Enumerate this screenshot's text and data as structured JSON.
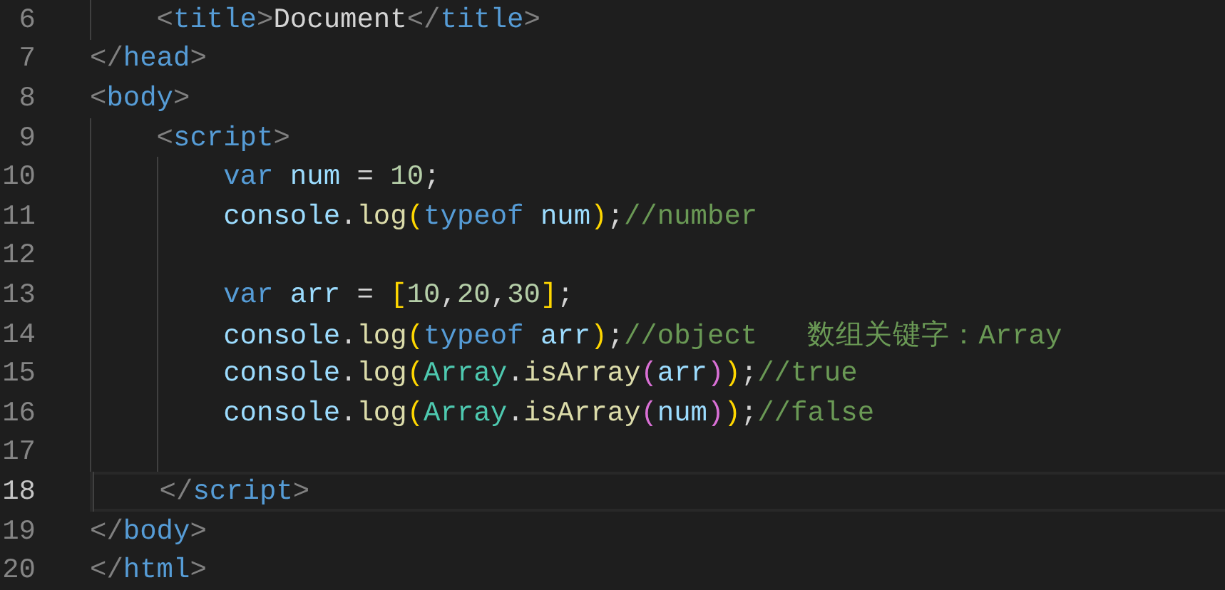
{
  "editor": {
    "lines": [
      {
        "children": [
          {
            "number": "6",
            "current": false,
            "tokens": [
              {
                "kind": "tagbracket",
                "text": "<"
              },
              {
                "kind": "tag",
                "text": "title"
              },
              {
                "kind": "tagbracket",
                "text": ">"
              },
              {
                "kind": "text",
                "text": "Document"
              },
              {
                "kind": "tagbracket",
                "text": "</"
              },
              {
                "kind": "tag",
                "text": "title"
              },
              {
                "kind": "tagbracket",
                "text": ">"
              }
            ]
          }
        ]
      },
      {
        "number": "7",
        "current": false,
        "tokens": [
          {
            "kind": "tagbracket",
            "text": "</"
          },
          {
            "kind": "tag",
            "text": "head"
          },
          {
            "kind": "tagbracket",
            "text": ">"
          }
        ]
      },
      {
        "number": "8",
        "current": false,
        "tokens": [
          {
            "kind": "tagbracket",
            "text": "<"
          },
          {
            "kind": "tag",
            "text": "body"
          },
          {
            "kind": "tagbracket",
            "text": ">"
          }
        ],
        "children": [
          {
            "number": "9",
            "current": false,
            "tokens": [
              {
                "kind": "tagbracket",
                "text": "<"
              },
              {
                "kind": "tag",
                "text": "script"
              },
              {
                "kind": "tagbracket",
                "text": ">"
              }
            ],
            "children": [
              {
                "number": "10",
                "current": false,
                "tokens": [
                  {
                    "kind": "keyword",
                    "text": "var "
                  },
                  {
                    "kind": "variable",
                    "text": "num"
                  },
                  {
                    "kind": "punct",
                    "text": " = "
                  },
                  {
                    "kind": "number",
                    "text": "10"
                  },
                  {
                    "kind": "punct",
                    "text": ";"
                  }
                ]
              },
              {
                "number": "11",
                "current": false,
                "tokens": [
                  {
                    "kind": "variable",
                    "text": "console"
                  },
                  {
                    "kind": "punct",
                    "text": "."
                  },
                  {
                    "kind": "function",
                    "text": "log"
                  },
                  {
                    "kind": "bracket1",
                    "text": "("
                  },
                  {
                    "kind": "keyword",
                    "text": "typeof "
                  },
                  {
                    "kind": "variable",
                    "text": "num"
                  },
                  {
                    "kind": "bracket1",
                    "text": ")"
                  },
                  {
                    "kind": "punct",
                    "text": ";"
                  },
                  {
                    "kind": "comment",
                    "text": "//number"
                  }
                ]
              },
              {
                "number": "12",
                "current": false
              },
              {
                "number": "13",
                "current": false,
                "tokens": [
                  {
                    "kind": "keyword",
                    "text": "var "
                  },
                  {
                    "kind": "variable",
                    "text": "arr"
                  },
                  {
                    "kind": "punct",
                    "text": " = "
                  },
                  {
                    "kind": "bracket1",
                    "text": "["
                  },
                  {
                    "kind": "number",
                    "text": "10"
                  },
                  {
                    "kind": "punct",
                    "text": ","
                  },
                  {
                    "kind": "number",
                    "text": "20"
                  },
                  {
                    "kind": "punct",
                    "text": ","
                  },
                  {
                    "kind": "number",
                    "text": "30"
                  },
                  {
                    "kind": "bracket1",
                    "text": "]"
                  },
                  {
                    "kind": "punct",
                    "text": ";"
                  }
                ]
              },
              {
                "number": "14",
                "current": false,
                "tokens": [
                  {
                    "kind": "variable",
                    "text": "console"
                  },
                  {
                    "kind": "punct",
                    "text": "."
                  },
                  {
                    "kind": "function",
                    "text": "log"
                  },
                  {
                    "kind": "bracket1",
                    "text": "("
                  },
                  {
                    "kind": "keyword",
                    "text": "typeof "
                  },
                  {
                    "kind": "variable",
                    "text": "arr"
                  },
                  {
                    "kind": "bracket1",
                    "text": ")"
                  },
                  {
                    "kind": "punct",
                    "text": ";"
                  },
                  {
                    "kind": "comment",
                    "text": "//object   数组关键字：Array"
                  }
                ]
              },
              {
                "number": "15",
                "current": false,
                "tokens": [
                  {
                    "kind": "variable",
                    "text": "console"
                  },
                  {
                    "kind": "punct",
                    "text": "."
                  },
                  {
                    "kind": "function",
                    "text": "log"
                  },
                  {
                    "kind": "bracket1",
                    "text": "("
                  },
                  {
                    "kind": "class",
                    "text": "Array"
                  },
                  {
                    "kind": "punct",
                    "text": "."
                  },
                  {
                    "kind": "function",
                    "text": "isArray"
                  },
                  {
                    "kind": "bracket2",
                    "text": "("
                  },
                  {
                    "kind": "variable",
                    "text": "arr"
                  },
                  {
                    "kind": "bracket2",
                    "text": ")"
                  },
                  {
                    "kind": "bracket1",
                    "text": ")"
                  },
                  {
                    "kind": "punct",
                    "text": ";"
                  },
                  {
                    "kind": "comment",
                    "text": "//true"
                  }
                ]
              },
              {
                "number": "16",
                "current": false,
                "tokens": [
                  {
                    "kind": "variable",
                    "text": "console"
                  },
                  {
                    "kind": "punct",
                    "text": "."
                  },
                  {
                    "kind": "function",
                    "text": "log"
                  },
                  {
                    "kind": "bracket1",
                    "text": "("
                  },
                  {
                    "kind": "class",
                    "text": "Array"
                  },
                  {
                    "kind": "punct",
                    "text": "."
                  },
                  {
                    "kind": "function",
                    "text": "isArray"
                  },
                  {
                    "kind": "bracket2",
                    "text": "("
                  },
                  {
                    "kind": "variable",
                    "text": "num"
                  },
                  {
                    "kind": "bracket2",
                    "text": ")"
                  },
                  {
                    "kind": "bracket1",
                    "text": ")"
                  },
                  {
                    "kind": "punct",
                    "text": ";"
                  },
                  {
                    "kind": "comment",
                    "text": "//false"
                  }
                ]
              },
              {
                "number": "17",
                "current": false
              }
            ]
          },
          {
            "number": "18",
            "current": true,
            "tokens": [
              {
                "kind": "tagbracket",
                "text": "</"
              },
              {
                "kind": "tag",
                "text": "script"
              },
              {
                "kind": "tagbracket",
                "text": ">"
              }
            ]
          }
        ]
      },
      {
        "number": "19",
        "current": false,
        "tokens": [
          {
            "kind": "tagbracket",
            "text": "</"
          },
          {
            "kind": "tag",
            "text": "body"
          },
          {
            "kind": "tagbracket",
            "text": ">"
          }
        ]
      },
      {
        "number": "20",
        "current": false,
        "tokens": [
          {
            "kind": "tagbracket",
            "text": "</"
          },
          {
            "kind": "tag",
            "text": "html"
          },
          {
            "kind": "tagbracket",
            "text": ">"
          }
        ]
      }
    ]
  }
}
